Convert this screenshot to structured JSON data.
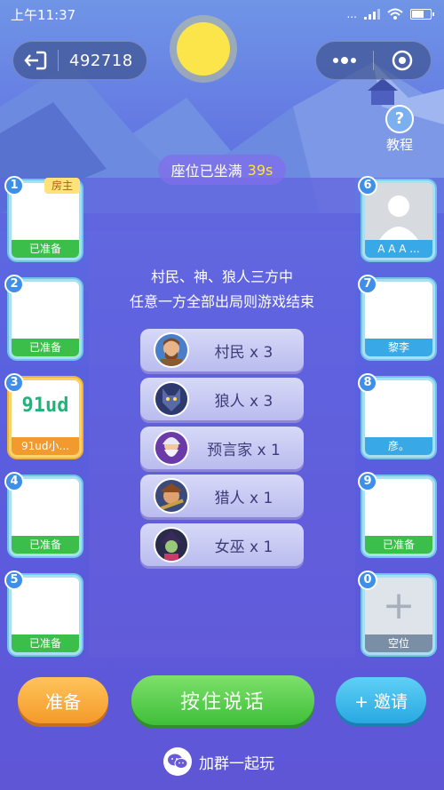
{
  "status_bar": {
    "time": "上午11:37",
    "network": "..."
  },
  "room": {
    "number": "492718"
  },
  "tutorial": {
    "label": "教程",
    "symbol": "?"
  },
  "seat_banner": {
    "text": "座位已坐满",
    "timer": "39s"
  },
  "rules": {
    "line1": "村民、神、狼人三方中",
    "line2": "任意一方全部出局则游戏结束"
  },
  "roles": [
    {
      "label": "村民 x 3",
      "icon": "villager-avatar"
    },
    {
      "label": "狼人 x 3",
      "icon": "werewolf-avatar"
    },
    {
      "label": "预言家 x 1",
      "icon": "seer-avatar"
    },
    {
      "label": "猎人 x 1",
      "icon": "hunter-avatar"
    },
    {
      "label": "女巫 x 1",
      "icon": "witch-avatar"
    }
  ],
  "host_tag": "房主",
  "seats": [
    {
      "num": "1",
      "status": "已准备",
      "color": "green"
    },
    {
      "num": "2",
      "status": "已准备",
      "color": "green"
    },
    {
      "num": "3",
      "status": "91ud小...",
      "color": "orange",
      "logo": "91ud"
    },
    {
      "num": "4",
      "status": "已准备",
      "color": "green"
    },
    {
      "num": "5",
      "status": "已准备",
      "color": "green"
    },
    {
      "num": "6",
      "status": "A A A ...",
      "color": "blue"
    },
    {
      "num": "7",
      "status": "黎李",
      "color": "blue"
    },
    {
      "num": "8",
      "status": "彦。",
      "color": "blue"
    },
    {
      "num": "9",
      "status": "已准备",
      "color": "green"
    },
    {
      "num": "0",
      "status": "空位",
      "color": "gray",
      "plus": "+"
    }
  ],
  "buttons": {
    "ready": "准备",
    "talk": "按住说话",
    "invite": "+ 邀请"
  },
  "group": {
    "text": "加群一起玩"
  },
  "colors": {
    "accent_green": "#3cbf4a",
    "accent_blue": "#38a8e6",
    "accent_orange": "#f39a2f",
    "timer": "#ffe04a"
  }
}
